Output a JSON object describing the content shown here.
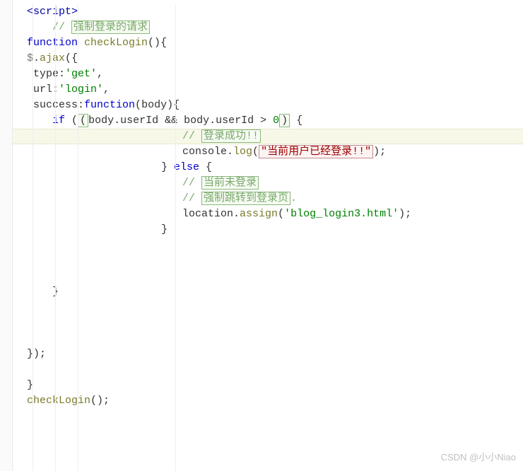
{
  "watermark": "CSDN @小小Niao",
  "code": {
    "tag_open": "<script>",
    "comment1_slash": "// ",
    "comment1_text": "强制登录的请求",
    "kw_function": "function",
    "fn_checkLogin": "checkLogin",
    "paren_empty": "()",
    "brace_open": "{",
    "jq": "$",
    "dot": ".",
    "fn_ajax": "ajax",
    "paren_open": "(",
    "brace_close": "}",
    "prop_type": " type",
    "colon": ":",
    "str_get": "'get'",
    "comma": ",",
    "prop_url": " url",
    "str_login": "'login'",
    "prop_success": " success",
    "param_body": "body",
    "paren_close": ")",
    "kw_if": "if",
    "cond_open": " (",
    "cond_inner_open": "(",
    "body_userId": "body.userId",
    "amp": " && ",
    "gt": " > ",
    "zero": "0",
    "cond_inner_close": ")",
    "cond_close": " {",
    "comment2_slash": "// ",
    "comment2_text": "登录成功!!",
    "console_obj": "console",
    "fn_log": "log",
    "str_logged": "\"当前用户已经登录!!\"",
    "semi": ";",
    "kw_else": " else ",
    "comment3_slash": "// ",
    "comment3_text": "当前未登录",
    "comment4_slash": "// ",
    "comment4_text": "强制跳转到登录页",
    "comment4_tail": ".",
    "location_obj": "location",
    "fn_assign": "assign",
    "str_html": "'blog_login3.html'",
    "close_paren_semi": ");",
    "fn_call_checkLogin": "checkLogin();"
  }
}
